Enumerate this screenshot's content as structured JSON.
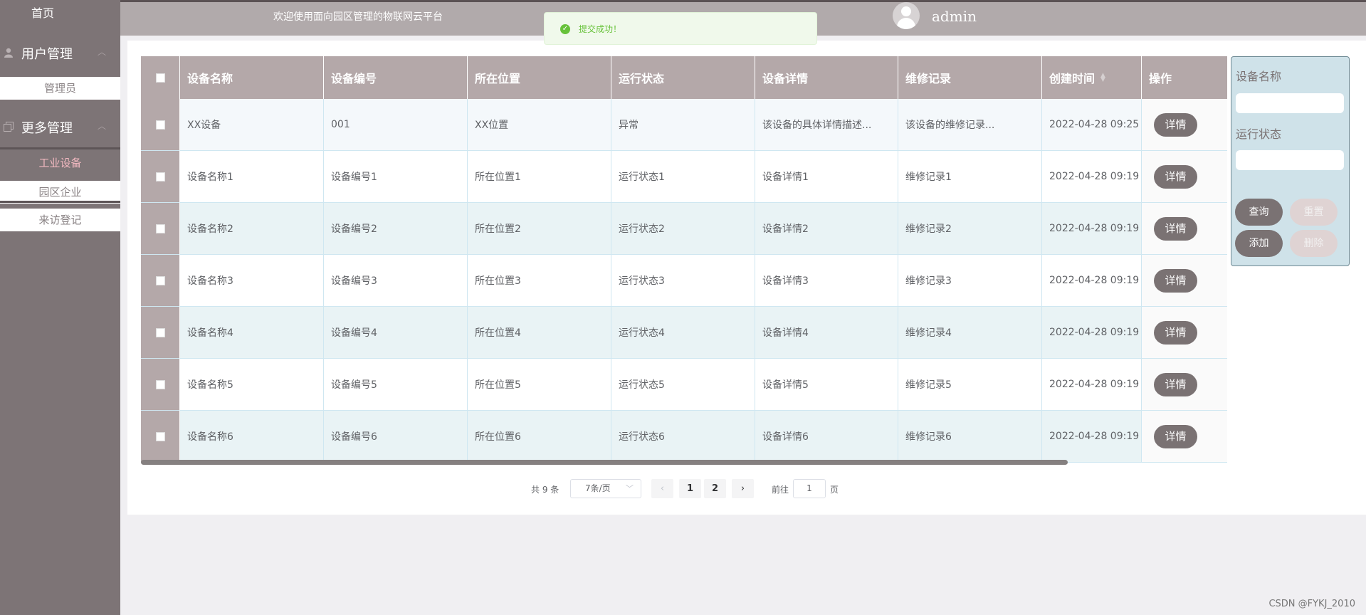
{
  "sidebar": {
    "home": "首页",
    "groups": [
      {
        "label": "用户管理",
        "items": [
          "管理员"
        ]
      },
      {
        "label": "更多管理",
        "items": [
          "工业设备",
          "园区企业",
          "来访登记"
        ]
      }
    ]
  },
  "topbar": {
    "welcome": "欢迎使用面向园区管理的物联网云平台",
    "username": "admin"
  },
  "toast": {
    "message": "提交成功！"
  },
  "table": {
    "headers": [
      "设备名称",
      "设备编号",
      "所在位置",
      "运行状态",
      "设备详情",
      "维修记录",
      "创建时间",
      "操作"
    ],
    "detail_label": "详情",
    "rows": [
      [
        "XX设备",
        "001",
        "XX位置",
        "异常",
        "该设备的具体详情描述...",
        "该设备的维修记录...",
        "2022-04-28 09:25"
      ],
      [
        "设备名称1",
        "设备编号1",
        "所在位置1",
        "运行状态1",
        "设备详情1",
        "维修记录1",
        "2022-04-28 09:19"
      ],
      [
        "设备名称2",
        "设备编号2",
        "所在位置2",
        "运行状态2",
        "设备详情2",
        "维修记录2",
        "2022-04-28 09:19"
      ],
      [
        "设备名称3",
        "设备编号3",
        "所在位置3",
        "运行状态3",
        "设备详情3",
        "维修记录3",
        "2022-04-28 09:19"
      ],
      [
        "设备名称4",
        "设备编号4",
        "所在位置4",
        "运行状态4",
        "设备详情4",
        "维修记录4",
        "2022-04-28 09:19"
      ],
      [
        "设备名称5",
        "设备编号5",
        "所在位置5",
        "运行状态5",
        "设备详情5",
        "维修记录5",
        "2022-04-28 09:19"
      ],
      [
        "设备名称6",
        "设备编号6",
        "所在位置6",
        "运行状态6",
        "设备详情6",
        "维修记录6",
        "2022-04-28 09:19"
      ]
    ]
  },
  "pagination": {
    "total": "共 9 条",
    "page_size": "7条/页",
    "pages": [
      "1",
      "2"
    ],
    "goto_label": "前往",
    "goto_value": "1",
    "page_suffix": "页"
  },
  "search": {
    "name_label": "设备名称",
    "status_label": "运行状态",
    "query": "查询",
    "reset": "重置",
    "add": "添加",
    "delete": "删除"
  },
  "watermark": "CSDN @FYKJ_2010",
  "colors": {
    "sidebar_bg": "#7d7476",
    "header_bg": "#b4a8a9",
    "button_dark": "#7a7273",
    "toast_green": "#67c23a"
  }
}
